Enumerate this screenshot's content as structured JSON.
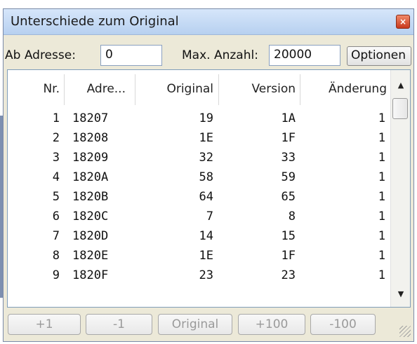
{
  "window": {
    "title": "Unterschiede zum Original",
    "close_glyph": "×"
  },
  "toolbar": {
    "start_label": "Ab Adresse:",
    "start_value": "0",
    "max_label": "Max. Anzahl:",
    "max_value": "20000",
    "options_label": "Optionen"
  },
  "table": {
    "columns": [
      "Nr.",
      "Adre...",
      "Original",
      "Version",
      "Änderung"
    ],
    "rows": [
      [
        "1",
        "18207",
        "19",
        "1A",
        "1"
      ],
      [
        "2",
        "18208",
        "1E",
        "1F",
        "1"
      ],
      [
        "3",
        "18209",
        "32",
        "33",
        "1"
      ],
      [
        "4",
        "1820A",
        "58",
        "59",
        "1"
      ],
      [
        "5",
        "1820B",
        "64",
        "65",
        "1"
      ],
      [
        "6",
        "1820C",
        "7",
        "8",
        "1"
      ],
      [
        "7",
        "1820D",
        "14",
        "15",
        "1"
      ],
      [
        "8",
        "1820E",
        "1E",
        "1F",
        "1"
      ],
      [
        "9",
        "1820F",
        "23",
        "23",
        "1"
      ]
    ]
  },
  "scrollbar": {
    "up_glyph": "▲",
    "down_glyph": "▼"
  },
  "buttons": {
    "plus1": "+1",
    "minus1": "-1",
    "original": "Original",
    "plus100": "+100",
    "minus100": "-100"
  }
}
